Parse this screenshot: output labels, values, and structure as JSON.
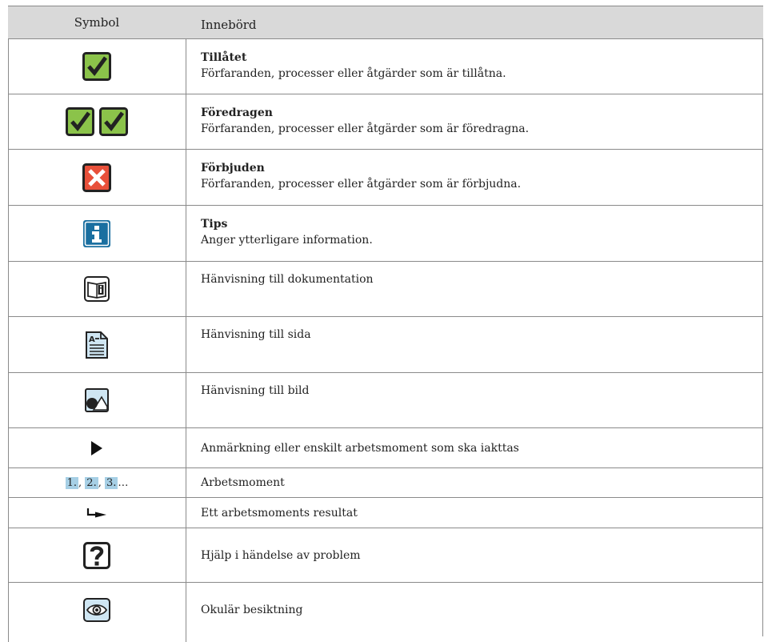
{
  "header": {
    "symbol": "Symbol",
    "content": "Innebörd"
  },
  "rows": [
    {
      "icon": "checkbox-checked-icon",
      "title": "Tillåtet",
      "desc": "Förfaranden, processer eller åtgärder som är tillåtna."
    },
    {
      "icon": "double-checkbox-checked-icon",
      "title": "Föredragen",
      "desc": "Förfaranden, processer eller åtgärder som är föredragna."
    },
    {
      "icon": "forbidden-x-icon",
      "title": "Förbjuden",
      "desc": "Förfaranden, processer eller åtgärder som är förbjudna."
    },
    {
      "icon": "info-tip-icon",
      "title": "Tips",
      "desc": "Anger ytterligare information."
    },
    {
      "icon": "book-reference-icon",
      "title": "",
      "desc": "Hänvisning till dokumentation"
    },
    {
      "icon": "page-reference-icon",
      "title": "",
      "desc": "Hänvisning till sida"
    },
    {
      "icon": "image-reference-icon",
      "title": "",
      "desc": "Hänvisning till bild"
    },
    {
      "icon": "triangle-arrow-icon",
      "title": "",
      "desc": "Anmärkning eller enskilt arbetsmoment som ska iakttas"
    },
    {
      "icon": "step-numbers",
      "title": "",
      "desc": "Arbetsmoment",
      "steps": [
        "1.",
        "2.",
        "3."
      ],
      "ellipsis": "…"
    },
    {
      "icon": "result-arrow-icon",
      "title": "",
      "desc": "Ett arbetsmoments resultat"
    },
    {
      "icon": "question-help-icon",
      "title": "",
      "desc": "Hjälp i händelse av problem"
    },
    {
      "icon": "eye-inspection-icon",
      "title": "",
      "desc": "Okulär besiktning"
    }
  ],
  "colors": {
    "check_green": "#8bc34a",
    "forbid_red": "#e8503a",
    "info_blue": "#1a6fa0",
    "header_bg": "#d9d9d9",
    "step_bg": "#a6cfe5"
  }
}
